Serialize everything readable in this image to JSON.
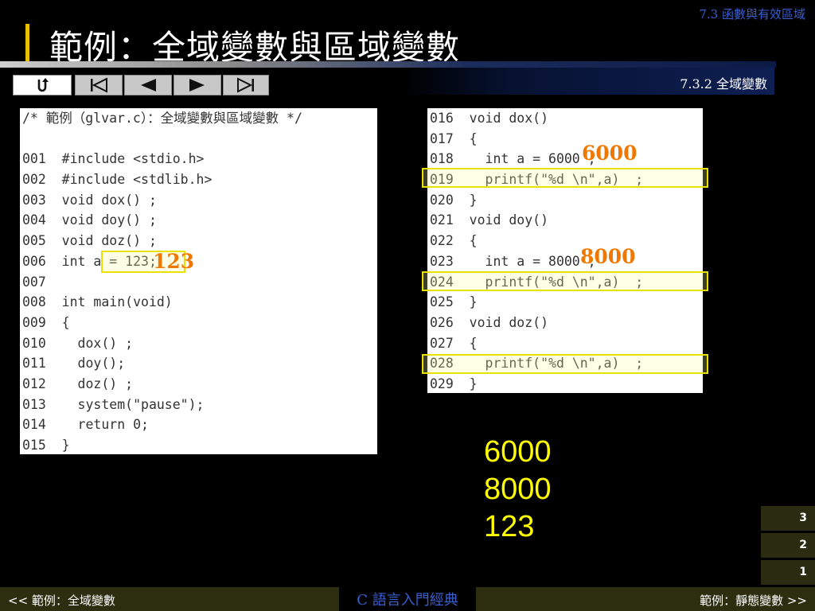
{
  "header": {
    "section": "7.3 函數與有效區域",
    "title": "範例：全域變數與區域變數",
    "subtitle": "7.3.2 全域變數"
  },
  "nav": {
    "home_icon": "return-u-arrow-icon",
    "first_icon": "first-slide-icon",
    "prev_icon": "previous-slide-icon",
    "next_icon": "next-slide-icon",
    "last_icon": "last-slide-icon"
  },
  "code_left": [
    "/* 範例（glvar.c）：全域變數與區域變數 */",
    "",
    "001  #include <stdio.h>",
    "002  #include <stdlib.h>",
    "003  void dox() ;",
    "004  void doy() ;",
    "005  void doz() ;",
    "006  int a = 123;",
    "007",
    "008  int main(void)",
    "009  {",
    "010    dox() ;",
    "011    doy();",
    "012    doz() ;",
    "013    system(\"pause\");",
    "014    return 0;",
    "015  }"
  ],
  "code_right": [
    "016  void dox()",
    "017  {",
    "018    int a = 6000 ;",
    "019    printf(\"%d \\n\",a)  ;",
    "020  }",
    "021  void doy()",
    "022  {",
    "023    int a = 8000 ;",
    "024    printf(\"%d \\n\",a)  ;",
    "025  }",
    "026  void doz()",
    "027  {",
    "028    printf(\"%d \\n\",a)  ;",
    "029  }"
  ],
  "overlays": {
    "v123": "123",
    "v6000": "6000",
    "v8000": "8000"
  },
  "output": [
    "6000",
    "8000",
    "123"
  ],
  "pages": [
    "3",
    "2",
    "1"
  ],
  "footer": {
    "prev": "<< 範例：全域變數",
    "book": "C 語言入門經典",
    "next": "範例：靜態變數 >>"
  },
  "colors": {
    "highlight": "#e8e200",
    "overlay_number": "#f07800",
    "output_text": "#ffff00",
    "section_blue": "#3a5fd0"
  }
}
